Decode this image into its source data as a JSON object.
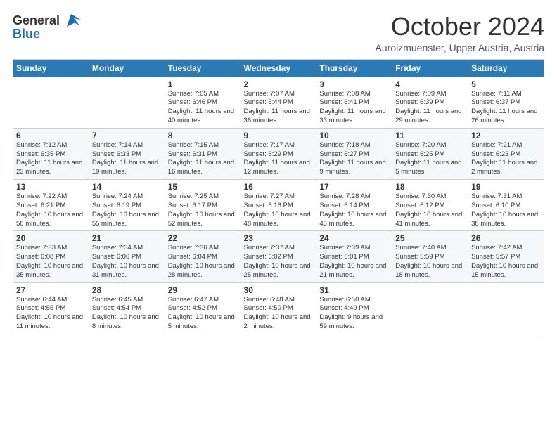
{
  "logo": {
    "general": "General",
    "blue": "Blue"
  },
  "header": {
    "month": "October 2024",
    "location": "Aurolzmuenster, Upper Austria, Austria"
  },
  "days_of_week": [
    "Sunday",
    "Monday",
    "Tuesday",
    "Wednesday",
    "Thursday",
    "Friday",
    "Saturday"
  ],
  "weeks": [
    [
      {
        "day": "",
        "info": ""
      },
      {
        "day": "",
        "info": ""
      },
      {
        "day": "1",
        "info": "Sunrise: 7:05 AM\nSunset: 6:46 PM\nDaylight: 11 hours and 40 minutes."
      },
      {
        "day": "2",
        "info": "Sunrise: 7:07 AM\nSunset: 6:44 PM\nDaylight: 11 hours and 36 minutes."
      },
      {
        "day": "3",
        "info": "Sunrise: 7:08 AM\nSunset: 6:41 PM\nDaylight: 11 hours and 33 minutes."
      },
      {
        "day": "4",
        "info": "Sunrise: 7:09 AM\nSunset: 6:39 PM\nDaylight: 11 hours and 29 minutes."
      },
      {
        "day": "5",
        "info": "Sunrise: 7:11 AM\nSunset: 6:37 PM\nDaylight: 11 hours and 26 minutes."
      }
    ],
    [
      {
        "day": "6",
        "info": "Sunrise: 7:12 AM\nSunset: 6:35 PM\nDaylight: 11 hours and 23 minutes."
      },
      {
        "day": "7",
        "info": "Sunrise: 7:14 AM\nSunset: 6:33 PM\nDaylight: 11 hours and 19 minutes."
      },
      {
        "day": "8",
        "info": "Sunrise: 7:15 AM\nSunset: 6:31 PM\nDaylight: 11 hours and 16 minutes."
      },
      {
        "day": "9",
        "info": "Sunrise: 7:17 AM\nSunset: 6:29 PM\nDaylight: 11 hours and 12 minutes."
      },
      {
        "day": "10",
        "info": "Sunrise: 7:18 AM\nSunset: 6:27 PM\nDaylight: 11 hours and 9 minutes."
      },
      {
        "day": "11",
        "info": "Sunrise: 7:20 AM\nSunset: 6:25 PM\nDaylight: 11 hours and 5 minutes."
      },
      {
        "day": "12",
        "info": "Sunrise: 7:21 AM\nSunset: 6:23 PM\nDaylight: 11 hours and 2 minutes."
      }
    ],
    [
      {
        "day": "13",
        "info": "Sunrise: 7:22 AM\nSunset: 6:21 PM\nDaylight: 10 hours and 58 minutes."
      },
      {
        "day": "14",
        "info": "Sunrise: 7:24 AM\nSunset: 6:19 PM\nDaylight: 10 hours and 55 minutes."
      },
      {
        "day": "15",
        "info": "Sunrise: 7:25 AM\nSunset: 6:17 PM\nDaylight: 10 hours and 52 minutes."
      },
      {
        "day": "16",
        "info": "Sunrise: 7:27 AM\nSunset: 6:16 PM\nDaylight: 10 hours and 48 minutes."
      },
      {
        "day": "17",
        "info": "Sunrise: 7:28 AM\nSunset: 6:14 PM\nDaylight: 10 hours and 45 minutes."
      },
      {
        "day": "18",
        "info": "Sunrise: 7:30 AM\nSunset: 6:12 PM\nDaylight: 10 hours and 41 minutes."
      },
      {
        "day": "19",
        "info": "Sunrise: 7:31 AM\nSunset: 6:10 PM\nDaylight: 10 hours and 38 minutes."
      }
    ],
    [
      {
        "day": "20",
        "info": "Sunrise: 7:33 AM\nSunset: 6:08 PM\nDaylight: 10 hours and 35 minutes."
      },
      {
        "day": "21",
        "info": "Sunrise: 7:34 AM\nSunset: 6:06 PM\nDaylight: 10 hours and 31 minutes."
      },
      {
        "day": "22",
        "info": "Sunrise: 7:36 AM\nSunset: 6:04 PM\nDaylight: 10 hours and 28 minutes."
      },
      {
        "day": "23",
        "info": "Sunrise: 7:37 AM\nSunset: 6:02 PM\nDaylight: 10 hours and 25 minutes."
      },
      {
        "day": "24",
        "info": "Sunrise: 7:39 AM\nSunset: 6:01 PM\nDaylight: 10 hours and 21 minutes."
      },
      {
        "day": "25",
        "info": "Sunrise: 7:40 AM\nSunset: 5:59 PM\nDaylight: 10 hours and 18 minutes."
      },
      {
        "day": "26",
        "info": "Sunrise: 7:42 AM\nSunset: 5:57 PM\nDaylight: 10 hours and 15 minutes."
      }
    ],
    [
      {
        "day": "27",
        "info": "Sunrise: 6:44 AM\nSunset: 4:55 PM\nDaylight: 10 hours and 11 minutes."
      },
      {
        "day": "28",
        "info": "Sunrise: 6:45 AM\nSunset: 4:54 PM\nDaylight: 10 hours and 8 minutes."
      },
      {
        "day": "29",
        "info": "Sunrise: 6:47 AM\nSunset: 4:52 PM\nDaylight: 10 hours and 5 minutes."
      },
      {
        "day": "30",
        "info": "Sunrise: 6:48 AM\nSunset: 4:50 PM\nDaylight: 10 hours and 2 minutes."
      },
      {
        "day": "31",
        "info": "Sunrise: 6:50 AM\nSunset: 4:49 PM\nDaylight: 9 hours and 59 minutes."
      },
      {
        "day": "",
        "info": ""
      },
      {
        "day": "",
        "info": ""
      }
    ]
  ]
}
